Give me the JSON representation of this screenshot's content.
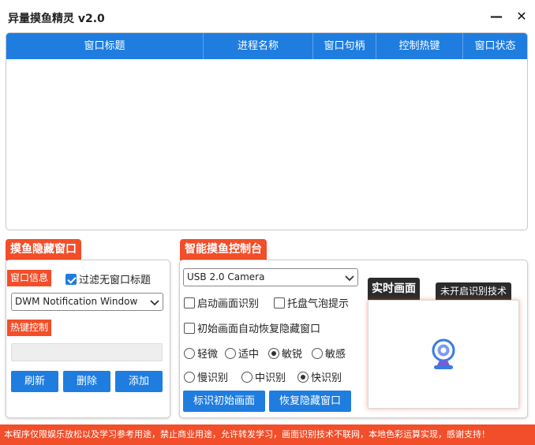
{
  "window": {
    "title": "异量摸鱼精灵 v2.0",
    "minimize_glyph": "—",
    "close_glyph": "✕"
  },
  "window_table": {
    "columns": [
      "窗口标题",
      "进程名称",
      "窗口句柄",
      "控制热键",
      "窗口状态"
    ],
    "rows": []
  },
  "hide_panel": {
    "section_title": "摸鱼隐藏窗口",
    "window_info_tag": "窗口信息",
    "filter_checkbox": {
      "label": "过滤无窗口标题",
      "checked": true
    },
    "window_select": {
      "value": "DWM Notification Window"
    },
    "hotkey_tag": "热键控制",
    "hotkey_input": {
      "value": ""
    },
    "buttons": {
      "refresh": "刷新",
      "delete": "删除",
      "add": "添加"
    }
  },
  "smart_panel": {
    "section_title": "智能摸鱼控制台",
    "camera_select": {
      "value": "USB 2.0 Camera"
    },
    "checkboxes": {
      "start_recognition": {
        "label": "启动画面识别",
        "checked": false
      },
      "tray_bubble": {
        "label": "托盘气泡提示",
        "checked": false
      },
      "auto_restore": {
        "label": "初始画面自动恢复隐藏窗口",
        "checked": false
      }
    },
    "sensitivity": {
      "options": [
        "轻微",
        "适中",
        "敏锐",
        "敏感"
      ],
      "selected": "敏锐"
    },
    "speed": {
      "options": [
        "慢识别",
        "中识别",
        "快识别"
      ],
      "selected": "快识别"
    },
    "buttons": {
      "mark_initial": "标识初始画面",
      "restore_hidden": "恢复隐藏窗口"
    },
    "live_tag": "实时画面",
    "status_badge": "未开启识别技术",
    "webcam_icon": "webcam-icon"
  },
  "footer": {
    "text": "本程序仅限娱乐放松以及学习参考用途，禁止商业用途，允许转发学习，画面识别技术不联网，本地色彩运算实现，感谢支持！"
  },
  "colors": {
    "accent_blue": "#1f7de0",
    "accent_red": "#f24e2a",
    "dark_badge": "#2b2b2b",
    "icon_blue": "#3a7be0",
    "icon_purple": "#7a5cd6"
  }
}
